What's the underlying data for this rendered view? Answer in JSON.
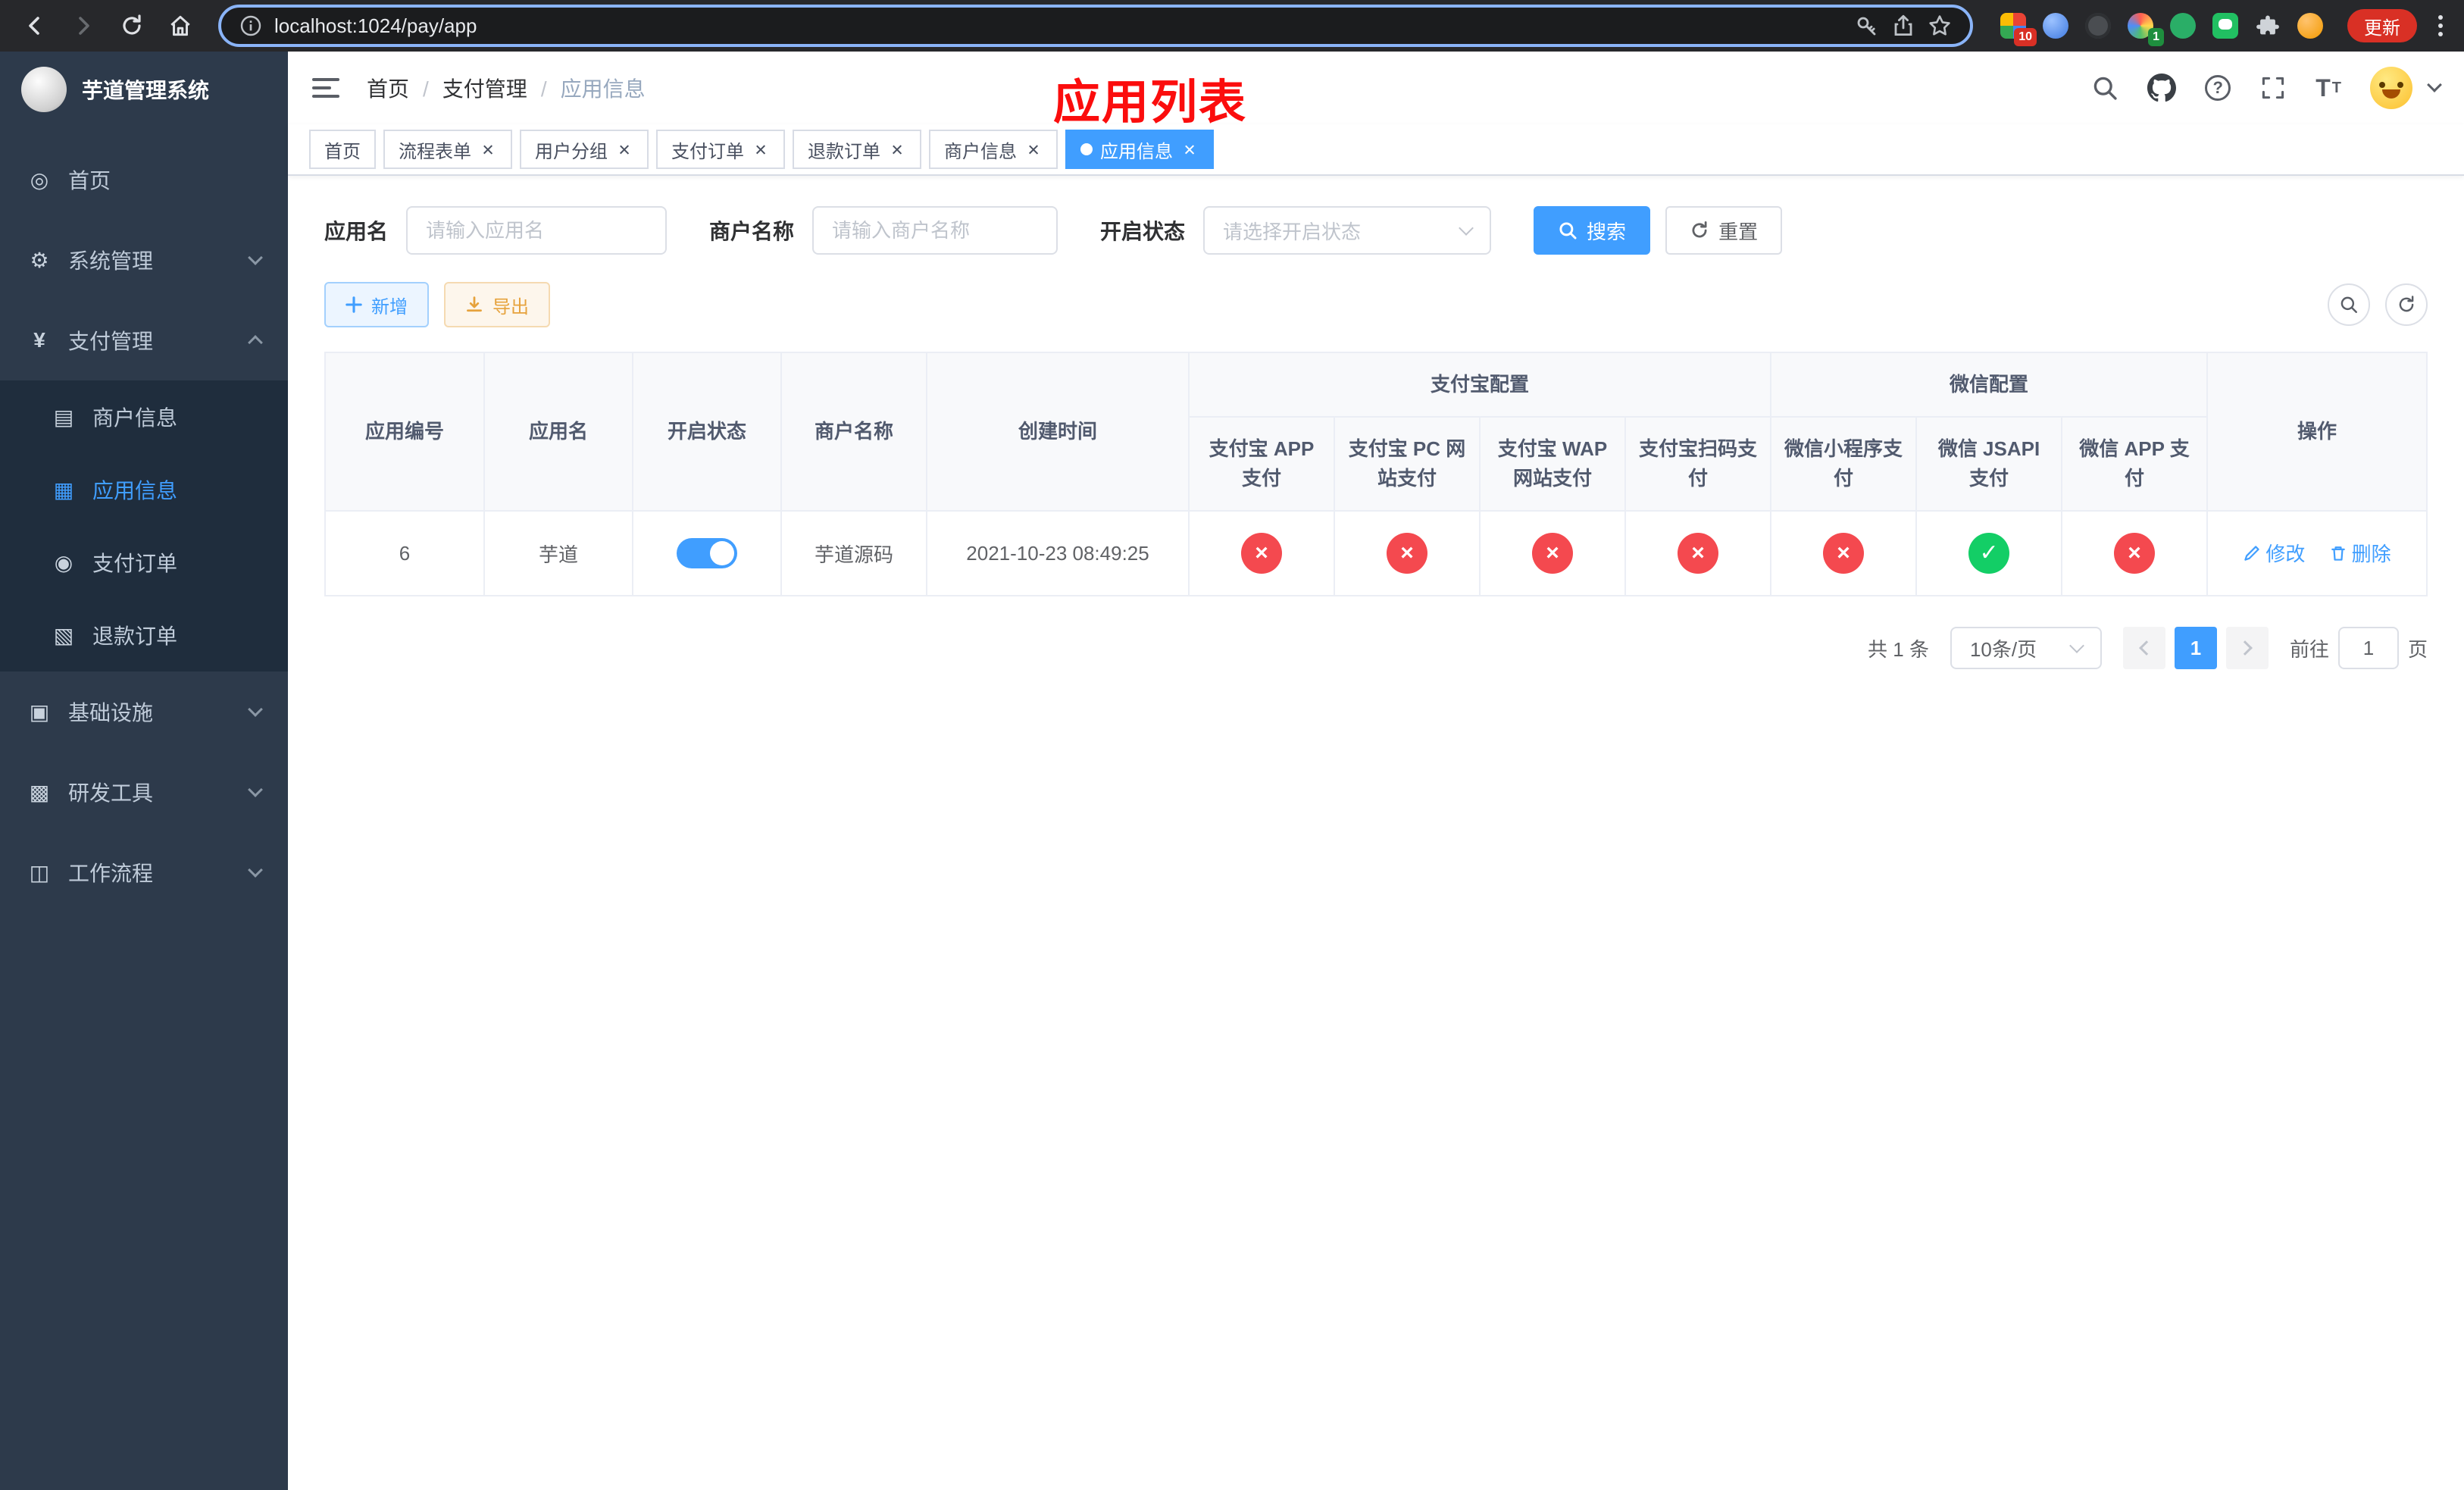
{
  "browser": {
    "url": "localhost:1024/pay/app",
    "update_label": "更新",
    "badge_red": "10",
    "badge_green": "1"
  },
  "sidebar": {
    "logo_title": "芋道管理系统",
    "home": "首页",
    "system": "系统管理",
    "pay": "支付管理",
    "pay_children": {
      "merchant": "商户信息",
      "app": "应用信息",
      "order": "支付订单",
      "refund": "退款订单"
    },
    "infra": "基础设施",
    "devtool": "研发工具",
    "workflow": "工作流程"
  },
  "header": {
    "breadcrumb": [
      "首页",
      "支付管理",
      "应用信息"
    ],
    "overlay_title": "应用列表"
  },
  "tabs": [
    {
      "label": "首页"
    },
    {
      "label": "流程表单"
    },
    {
      "label": "用户分组"
    },
    {
      "label": "支付订单"
    },
    {
      "label": "退款订单"
    },
    {
      "label": "商户信息"
    },
    {
      "label": "应用信息"
    }
  ],
  "filters": {
    "app_name_label": "应用名",
    "app_name_placeholder": "请输入应用名",
    "merchant_label": "商户名称",
    "merchant_placeholder": "请输入商户名称",
    "status_label": "开启状态",
    "status_placeholder": "请选择开启状态",
    "search_label": "搜索",
    "reset_label": "重置"
  },
  "toolbar": {
    "add_label": "新增",
    "export_label": "导出"
  },
  "table": {
    "headers": {
      "row1": [
        "应用编号",
        "应用名",
        "开启状态",
        "商户名称",
        "创建时间",
        "支付宝配置",
        "微信配置",
        "操作"
      ],
      "row2": [
        "支付宝 APP 支付",
        "支付宝 PC 网站支付",
        "支付宝 WAP 网站支付",
        "支付宝扫码支付",
        "微信小程序支付",
        "微信 JSAPI 支付",
        "微信 APP 支付"
      ]
    },
    "row": {
      "id": "6",
      "name": "芋道",
      "enabled": true,
      "merchant": "芋道源码",
      "created_at": "2021-10-23 08:49:25",
      "statuses": [
        false,
        false,
        false,
        false,
        false,
        true,
        false
      ],
      "edit_label": "修改",
      "delete_label": "删除"
    }
  },
  "icons": {
    "check": "✓",
    "cross": "×"
  },
  "pagination": {
    "total": "共 1 条",
    "page_size": "10条/页",
    "page": "1",
    "goto_label": "前往",
    "goto_value": "1",
    "unit_label": "页"
  },
  "colors": {
    "primary": "#409eff",
    "danger": "#f4494f",
    "success": "#13ce66",
    "sidebar": "#2d3a4b"
  }
}
